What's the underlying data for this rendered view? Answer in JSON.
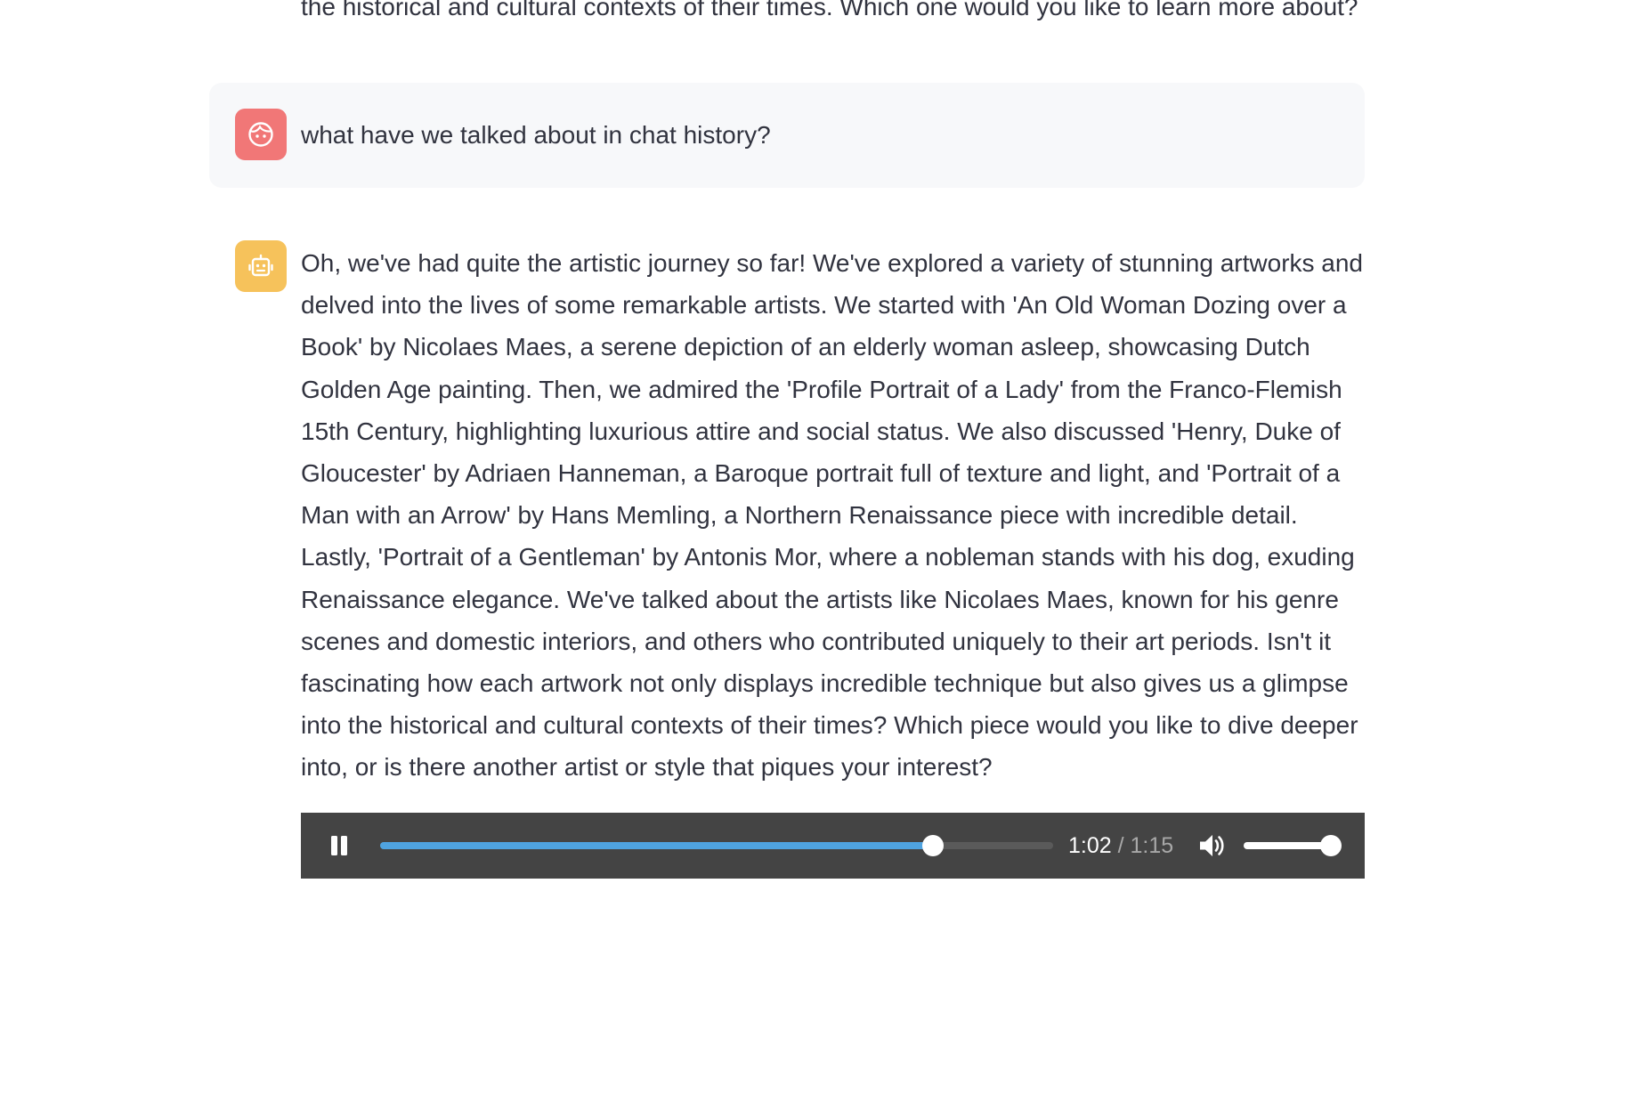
{
  "previous_message": {
    "text": "the historical and cultural contexts of their times. Which one would you like to learn more about?"
  },
  "user_message": {
    "avatar_icon": "user-face-icon",
    "avatar_color": "#f17777",
    "text": "what have we talked about in chat history?"
  },
  "assistant_message": {
    "avatar_icon": "robot-icon",
    "avatar_color": "#f6c25b",
    "text": "Oh, we've had quite the artistic journey so far! We've explored a variety of stunning artworks and delved into the lives of some remarkable artists. We started with 'An Old Woman Dozing over a Book' by Nicolaes Maes, a serene depiction of an elderly woman asleep, showcasing Dutch Golden Age painting. Then, we admired the 'Profile Portrait of a Lady' from the Franco-Flemish 15th Century, highlighting luxurious attire and social status. We also discussed 'Henry, Duke of Gloucester' by Adriaen Hanneman, a Baroque portrait full of texture and light, and 'Portrait of a Man with an Arrow' by Hans Memling, a Northern Renaissance piece with incredible detail. Lastly, 'Portrait of a Gentleman' by Antonis Mor, where a nobleman stands with his dog, exuding Renaissance elegance. We've talked about the artists like Nicolaes Maes, known for his genre scenes and domestic interiors, and others who contributed uniquely to their art periods. Isn't it fascinating how each artwork not only displays incredible technique but also gives us a glimpse into the historical and cultural contexts of their times? Which piece would you like to dive deeper into, or is there another artist or style that piques your interest?"
  },
  "audio_player": {
    "state": "playing",
    "control_icon": "pause-icon",
    "current_time": "1:02",
    "separator": "/",
    "total_time": "1:15",
    "progress_fraction": 0.822,
    "volume_icon": "volume-icon",
    "volume_fraction": 1.0,
    "progress_color": "#4fa3e0",
    "background_color": "#444444"
  }
}
